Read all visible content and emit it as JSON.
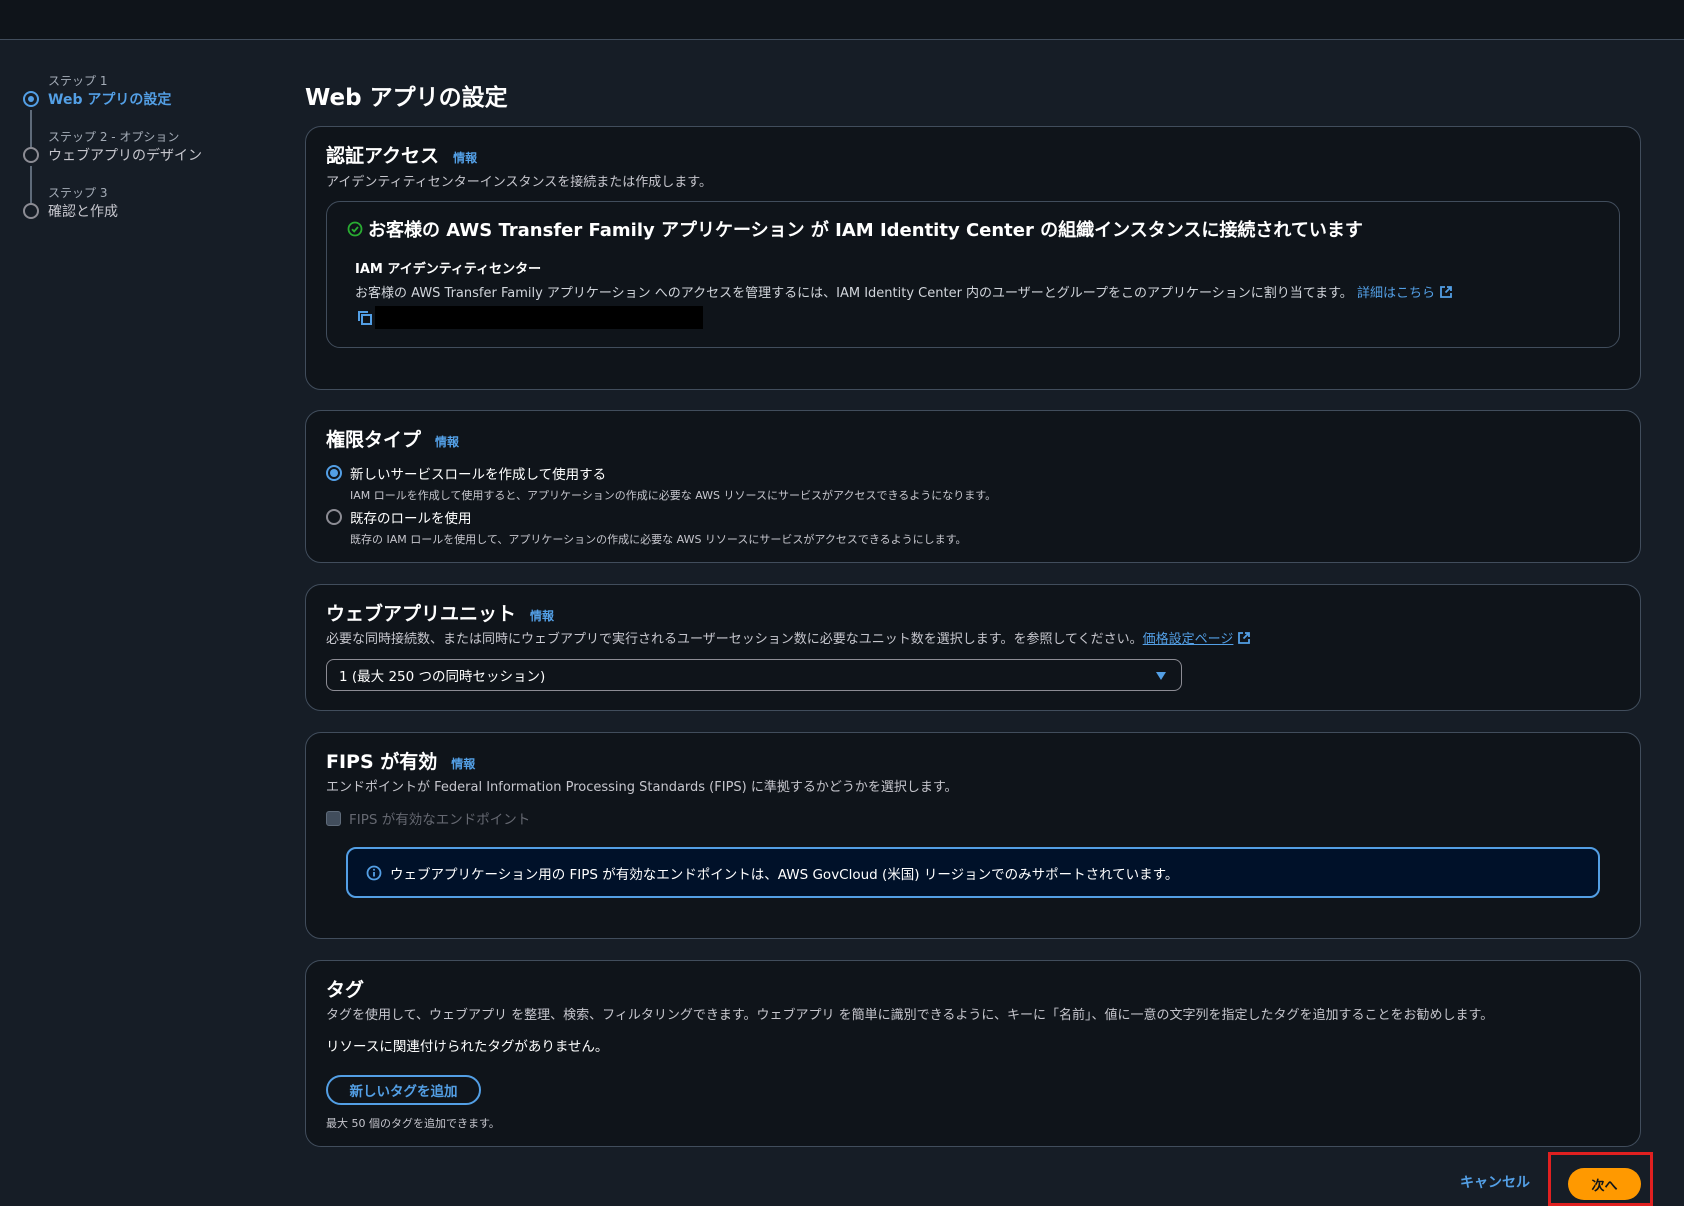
{
  "steps": [
    {
      "num": "ステップ 1",
      "title": "Web アプリの設定",
      "active": true
    },
    {
      "num": "ステップ 2 - オプション",
      "title": "ウェブアプリのデザイン",
      "active": false
    },
    {
      "num": "ステップ 3",
      "title": "確認と作成",
      "active": false
    }
  ],
  "page_title": "Web アプリの設定",
  "info_label": "情報",
  "auth": {
    "heading": "認証アクセス",
    "desc": "アイデンティティセンターインスタンスを接続または作成します。",
    "success_title": "お客様の AWS Transfer Family アプリケーション が IAM Identity Center の組織インスタンスに接続されています",
    "sub_heading": "IAM アイデンティティセンター",
    "sub_desc": "お客様の AWS Transfer Family アプリケーション へのアクセスを管理するには、IAM Identity Center 内のユーザーとグループをこのアプリケーションに割り当てます。",
    "learn_more": "詳細はこちら"
  },
  "permission": {
    "heading": "権限タイプ",
    "options": [
      {
        "label": "新しいサービスロールを作成して使用する",
        "desc": "IAM ロールを作成して使用すると、アプリケーションの作成に必要な AWS リソースにサービスがアクセスできるようになります。",
        "checked": true
      },
      {
        "label": "既存のロールを使用",
        "desc": "既存の IAM ロールを使用して、アプリケーションの作成に必要な AWS リソースにサービスがアクセスできるようにします。",
        "checked": false
      }
    ]
  },
  "units": {
    "heading": "ウェブアプリユニット",
    "desc": "必要な同時接続数、または同時にウェブアプリで実行されるユーザーセッション数に必要なユニット数を選択します。を参照してください。",
    "pricing_link": "価格設定ページ",
    "selected": "1 (最大 250 つの同時セッション)"
  },
  "fips": {
    "heading": "FIPS が有効",
    "desc": "エンドポイントが Federal Information Processing Standards (FIPS) に準拠するかどうかを選択します。",
    "checkbox_label": "FIPS が有効なエンドポイント",
    "alert": "ウェブアプリケーション用の FIPS が有効なエンドポイントは、AWS GovCloud (米国) リージョンでのみサポートされています。"
  },
  "tags": {
    "heading": "タグ",
    "desc": "タグを使用して、ウェブアプリ を整理、検索、フィルタリングできます。ウェブアプリ を簡単に識別できるように、キーに「名前」、値に一意の文字列を指定したタグを追加することをお勧めします。",
    "empty": "リソースに関連付けられたタグがありません。",
    "add_button": "新しいタグを追加",
    "hint": "最大 50 個のタグを追加できます。"
  },
  "footer": {
    "cancel": "キャンセル",
    "next": "次へ"
  },
  "colors": {
    "accent": "#539fe5",
    "primary_button": "#ff9900",
    "success": "#29ad32",
    "highlight": "#e02020"
  }
}
